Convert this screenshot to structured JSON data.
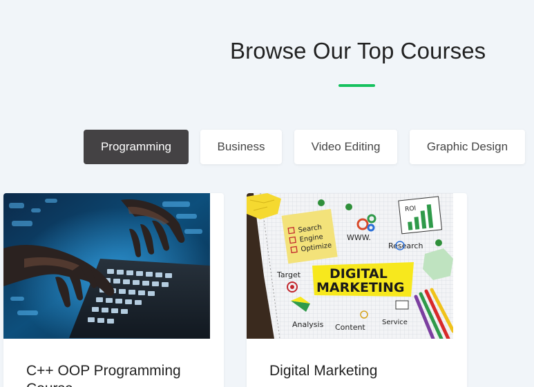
{
  "section": {
    "title": "Browse Our Top Courses"
  },
  "tabs": [
    {
      "label": "Programming",
      "active": true
    },
    {
      "label": "Business",
      "active": false
    },
    {
      "label": "Video Editing",
      "active": false
    },
    {
      "label": "Graphic Design",
      "active": false
    }
  ],
  "courses": [
    {
      "title": "C++ OOP Programming Course"
    },
    {
      "title": "Digital Marketing",
      "image_text": {
        "headline_line1": "DIGITAL",
        "headline_line2": "MARKETING",
        "note_line1": "Search",
        "note_line2": "Engine",
        "note_line3": "Optimize",
        "www": "WWW.",
        "roi": "ROI",
        "research": "Research",
        "target": "Target",
        "analysis": "Analysis",
        "content": "Content",
        "service": "Service"
      }
    }
  ],
  "colors": {
    "background": "#f1f5f9",
    "accent": "#16c15e",
    "active_tab": "#444244"
  }
}
